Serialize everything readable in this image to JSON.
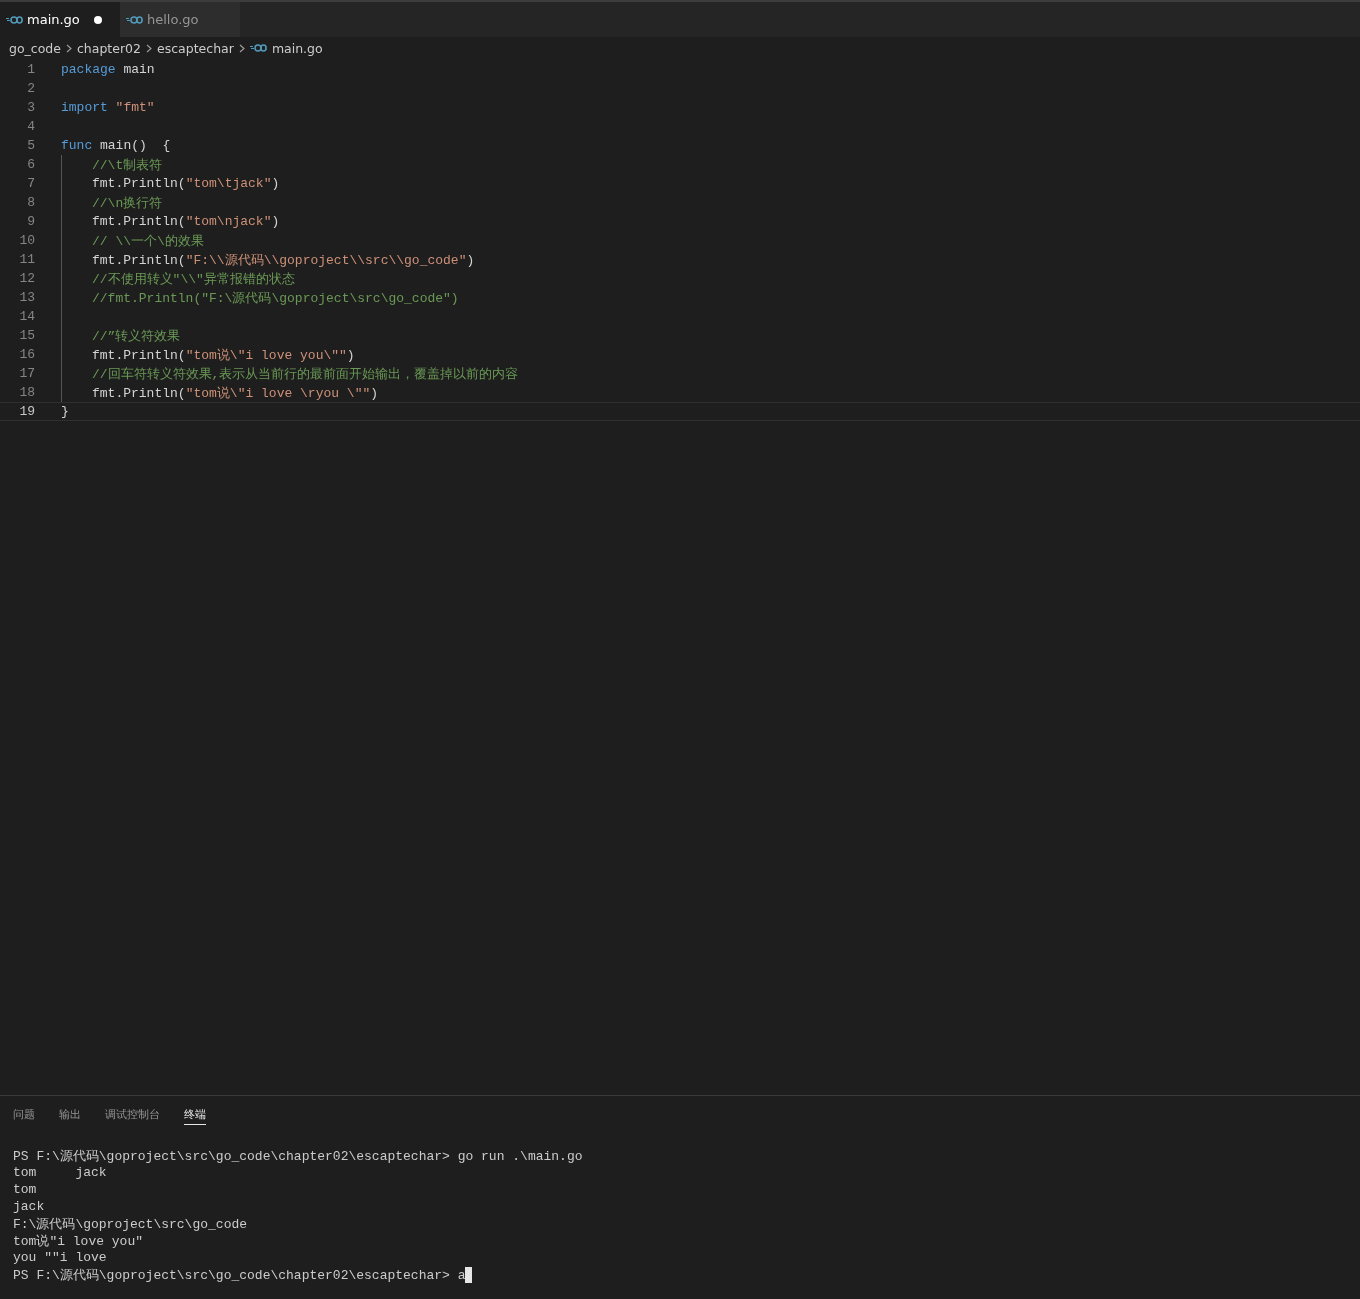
{
  "tabs": [
    {
      "label": "main.go",
      "selected": true,
      "modified": true
    },
    {
      "label": "hello.go",
      "selected": false,
      "modified": false
    }
  ],
  "breadcrumb": [
    "go_code",
    "chapter02",
    "escaptechar",
    "main.go"
  ],
  "code_lines": [
    {
      "number": "1",
      "current": false,
      "indented": false,
      "tokens": [
        {
          "kind": "keyword",
          "text": "package"
        },
        {
          "kind": "plain",
          "text": " main"
        }
      ]
    },
    {
      "number": "2",
      "current": false,
      "indented": false
    },
    {
      "number": "3",
      "current": false,
      "indented": false,
      "tokens": [
        {
          "kind": "keyword",
          "text": "import"
        },
        {
          "kind": "string",
          "text": " \"fmt\""
        }
      ]
    },
    {
      "number": "4",
      "current": false,
      "indented": false
    },
    {
      "number": "5",
      "current": false,
      "indented": false,
      "tokens": [
        {
          "kind": "keyword",
          "text": "func"
        },
        {
          "kind": "plain",
          "text": " main()  {"
        }
      ]
    },
    {
      "number": "6",
      "current": false,
      "indented": true,
      "tokens": [
        {
          "kind": "comment",
          "text": "//\\t制表符"
        }
      ]
    },
    {
      "number": "7",
      "current": false,
      "indented": true,
      "tokens": [
        {
          "kind": "plain",
          "text": "fmt.Println("
        },
        {
          "kind": "string",
          "text": "\"tom\\tjack\""
        },
        {
          "kind": "plain",
          "text": ")"
        }
      ]
    },
    {
      "number": "8",
      "current": false,
      "indented": true,
      "tokens": [
        {
          "kind": "comment",
          "text": "//\\n换行符"
        }
      ]
    },
    {
      "number": "9",
      "current": false,
      "indented": true,
      "tokens": [
        {
          "kind": "plain",
          "text": "fmt.Println("
        },
        {
          "kind": "string",
          "text": "\"tom\\njack\""
        },
        {
          "kind": "plain",
          "text": ")"
        }
      ]
    },
    {
      "number": "10",
      "current": false,
      "indented": true,
      "tokens": [
        {
          "kind": "comment",
          "text": "// \\\\一个\\的效果"
        }
      ]
    },
    {
      "number": "11",
      "current": false,
      "indented": true,
      "tokens": [
        {
          "kind": "plain",
          "text": "fmt.Println("
        },
        {
          "kind": "string",
          "text": "\"F:\\\\源代码\\\\goproject\\\\src\\\\go_code\""
        },
        {
          "kind": "plain",
          "text": ")"
        }
      ]
    },
    {
      "number": "12",
      "current": false,
      "indented": true,
      "tokens": [
        {
          "kind": "comment",
          "text": "//不使用转义\"\\\\\"异常报错的状态"
        }
      ]
    },
    {
      "number": "13",
      "current": false,
      "indented": true,
      "tokens": [
        {
          "kind": "comment",
          "text": "//fmt.Println(\"F:\\源代码\\goproject\\src\\go_code\")"
        }
      ]
    },
    {
      "number": "14",
      "current": false,
      "indented": true
    },
    {
      "number": "15",
      "current": false,
      "indented": true,
      "tokens": [
        {
          "kind": "comment",
          "text": "//”转义符效果"
        }
      ]
    },
    {
      "number": "16",
      "current": false,
      "indented": true,
      "tokens": [
        {
          "kind": "plain",
          "text": "fmt.Println("
        },
        {
          "kind": "string",
          "text": "\"tom说\\\"i love you\\\"\""
        },
        {
          "kind": "plain",
          "text": ")"
        }
      ]
    },
    {
      "number": "17",
      "current": false,
      "indented": true,
      "tokens": [
        {
          "kind": "comment",
          "text": "//回车符转义符效果,表示从当前行的最前面开始输出，覆盖掉以前的内容"
        }
      ]
    },
    {
      "number": "18",
      "current": false,
      "indented": true,
      "tokens": [
        {
          "kind": "plain",
          "text": "fmt.Println("
        },
        {
          "kind": "string",
          "text": "\"tom说\\\"i love \\ryou \\\"\""
        },
        {
          "kind": "plain",
          "text": ")"
        }
      ]
    },
    {
      "number": "19",
      "current": true,
      "indented": false,
      "tokens": [
        {
          "kind": "plain",
          "text": "}"
        }
      ]
    }
  ],
  "panel_tabs": [
    {
      "label": "问题",
      "selected": false
    },
    {
      "label": "输出",
      "selected": false
    },
    {
      "label": "调试控制台",
      "selected": false
    },
    {
      "label": "终端",
      "selected": true
    }
  ],
  "terminal_lines": [
    "PS F:\\源代码\\goproject\\src\\go_code\\chapter02\\escaptechar> go run .\\main.go",
    "tom\tjack",
    "tom",
    "jack",
    "F:\\源代码\\goproject\\src\\go_code",
    "tom说\"i love you\"",
    "you \"\"i love",
    "PS F:\\源代码\\goproject\\src\\go_code\\chapter02\\escaptechar> a"
  ]
}
